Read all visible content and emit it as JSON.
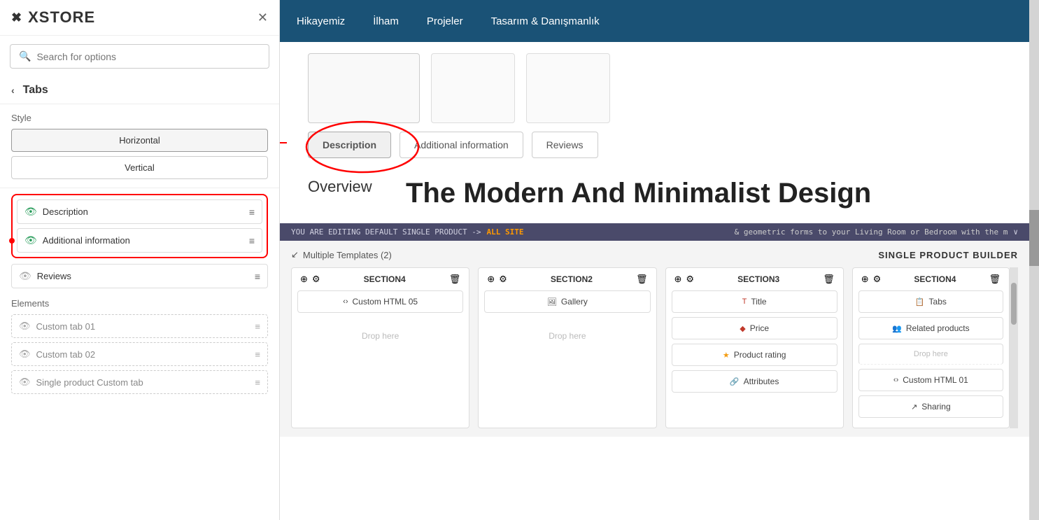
{
  "sidebar": {
    "logo": "XSTORE",
    "search_placeholder": "Search for options",
    "section_title": "Tabs",
    "style_label": "Style",
    "style_options": [
      "Horizontal",
      "Vertical"
    ],
    "tab_items": [
      {
        "id": "description",
        "label": "Description",
        "visible": true,
        "highlighted": true
      },
      {
        "id": "additional",
        "label": "Additional information",
        "visible": true,
        "highlighted": true
      },
      {
        "id": "reviews",
        "label": "Reviews",
        "visible": false,
        "highlighted": false
      }
    ],
    "elements_label": "Elements",
    "element_items": [
      {
        "id": "custom-tab-01",
        "label": "Custom tab 01"
      },
      {
        "id": "custom-tab-02",
        "label": "Custom tab 02"
      },
      {
        "id": "single-product-custom-tab",
        "label": "Single product Custom tab"
      }
    ]
  },
  "nav": {
    "items": [
      "Hikayemiz",
      "İlham",
      "Projeler",
      "Tasarım & Danışmanlık"
    ]
  },
  "preview": {
    "tab_buttons": [
      "Description",
      "Additional information",
      "Reviews"
    ],
    "active_tab": "Description",
    "overview_label": "Overview",
    "overview_title": "The Modern And Minimalist Design",
    "overview_text": "& geometric forms to your Living Room or Bedroom with the m"
  },
  "editing_bar": {
    "text": "YOU ARE EDITING DEFAULT SINGLE PRODUCT -> ",
    "highlight": "ALL SITE"
  },
  "builder": {
    "multiple_templates_label": "Multiple Templates (2)",
    "single_product_builder_label": "SINGLE PRODUCT BUILDER",
    "sections": [
      {
        "id": "section4a",
        "title": "SECTION4",
        "widgets": [
          "Custom HTML 05"
        ],
        "drop_here": "Drop here"
      },
      {
        "id": "section2",
        "title": "SECTION2",
        "widgets": [
          "Gallery"
        ],
        "drop_here": "Drop here"
      },
      {
        "id": "section3",
        "title": "SECTION3",
        "widgets": [
          "Title",
          "Price",
          "Product rating",
          "Attributes"
        ]
      },
      {
        "id": "section4b",
        "title": "SECTION4",
        "widgets": [
          "Tabs",
          "Related products",
          "Custom HTML 01",
          "Sharing"
        ]
      }
    ]
  },
  "icons": {
    "close": "✕",
    "back_arrow": "‹",
    "search": "🔍",
    "eye_green": "👁",
    "eye_gray": "👁",
    "drag": "≡",
    "move": "⊕",
    "gear": "⚙",
    "trash": "🗑",
    "custom_html": "‹›",
    "gallery": "🖼",
    "title": "T",
    "price": "💲",
    "star": "★",
    "attributes": "🔗",
    "tabs": "📋",
    "related": "👥",
    "sharing": "↗",
    "templates": "↙"
  }
}
